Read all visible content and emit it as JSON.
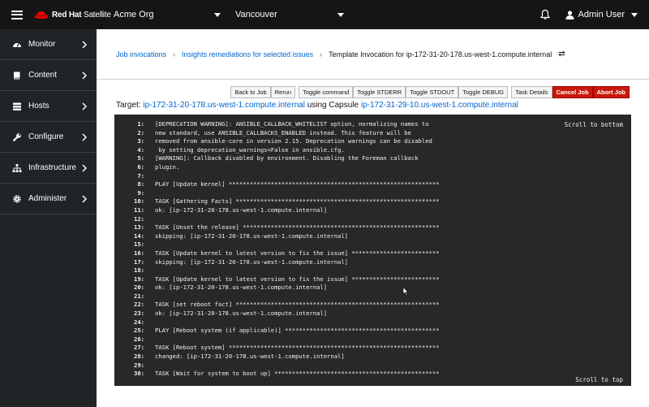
{
  "masthead": {
    "brand_bold": "Red Hat",
    "brand_light": " Satellite",
    "organization": "Acme Org",
    "location": "Vancouver",
    "user": "Admin User"
  },
  "sidebar": {
    "items": [
      {
        "label": "Monitor",
        "icon": "dashboard-icon"
      },
      {
        "label": "Content",
        "icon": "book-icon"
      },
      {
        "label": "Hosts",
        "icon": "server-icon"
      },
      {
        "label": "Configure",
        "icon": "wrench-icon"
      },
      {
        "label": "Infrastructure",
        "icon": "network-icon"
      },
      {
        "label": "Administer",
        "icon": "gear-icon"
      }
    ]
  },
  "breadcrumb": {
    "items": [
      "Job invocations",
      "Insights remediations for selected issues"
    ],
    "current": "Template Invocation for ip-172-31-20-178.us-west-1.compute.internal",
    "switcher": "⇄"
  },
  "toolbar": {
    "back_to_job": "Back to Job",
    "rerun": "Rerun",
    "toggle_command": "Toggle command",
    "toggle_stderr": "Toggle STDERR",
    "toggle_stdout": "Toggle STDOUT",
    "toggle_debug": "Toggle DEBUG",
    "task_details": "Task Details",
    "cancel_job": "Cancel Job",
    "abort_job": "Abort Job"
  },
  "target": {
    "label": "Target:",
    "host": "ip-172-31-20-178.us-west-1.compute.internal",
    "using": "using Capsule",
    "capsule": "ip-172-31-29-10.us-west-1.compute.internal"
  },
  "terminal": {
    "scroll_to_bottom": "Scroll to bottom",
    "scroll_to_top": "Scroll to top",
    "lines": [
      {
        "n": "1:",
        "t": "[DEPRECATION WARNING]: ANSIBLE_CALLBACK_WHITELIST option, normalizing names to"
      },
      {
        "n": "2:",
        "t": "new standard, use ANSIBLE_CALLBACKS_ENABLED instead. This feature will be"
      },
      {
        "n": "3:",
        "t": "removed from ansible-core in version 2.15. Deprecation warnings can be disabled"
      },
      {
        "n": "4:",
        "t": " by setting deprecation_warnings=False in ansible.cfg."
      },
      {
        "n": "5:",
        "t": "[WARNING]: Callback disabled by environment. Disabling the Foreman callback"
      },
      {
        "n": "6:",
        "t": "plugin."
      },
      {
        "n": "7:",
        "t": ""
      },
      {
        "n": "8:",
        "t": "PLAY [Update kernel] ************************************************************"
      },
      {
        "n": "9:",
        "t": ""
      },
      {
        "n": "10:",
        "t": "TASK [Gathering Facts] **********************************************************"
      },
      {
        "n": "11:",
        "t": "ok: [ip-172-31-20-178.us-west-1.compute.internal]"
      },
      {
        "n": "12:",
        "t": ""
      },
      {
        "n": "13:",
        "t": "TASK [Unset the release] ********************************************************"
      },
      {
        "n": "14:",
        "t": "skipping: [ip-172-31-20-178.us-west-1.compute.internal]"
      },
      {
        "n": "15:",
        "t": ""
      },
      {
        "n": "16:",
        "t": "TASK [Update kernel to latest version to fix the issue] *************************"
      },
      {
        "n": "17:",
        "t": "skipping: [ip-172-31-20-178.us-west-1.compute.internal]"
      },
      {
        "n": "18:",
        "t": ""
      },
      {
        "n": "19:",
        "t": "TASK [Update kernel to latest version to fix the issue] *************************"
      },
      {
        "n": "20:",
        "t": "ok: [ip-172-31-20-178.us-west-1.compute.internal]"
      },
      {
        "n": "21:",
        "t": ""
      },
      {
        "n": "22:",
        "t": "TASK [set reboot fact] **********************************************************"
      },
      {
        "n": "23:",
        "t": "ok: [ip-172-31-20-178.us-west-1.compute.internal]"
      },
      {
        "n": "24:",
        "t": ""
      },
      {
        "n": "25:",
        "t": "PLAY [Reboot system (if applicable)] ********************************************"
      },
      {
        "n": "26:",
        "t": ""
      },
      {
        "n": "27:",
        "t": "TASK [Reboot system] ************************************************************"
      },
      {
        "n": "28:",
        "t": "changed: [ip-172-31-20-178.us-west-1.compute.internal]"
      },
      {
        "n": "29:",
        "t": ""
      },
      {
        "n": "30:",
        "t": "TASK [Wait for system to boot up] ***********************************************"
      }
    ]
  },
  "colors": {
    "masthead_bg": "#151515",
    "sidebar_bg": "#212427",
    "link": "#0066cc",
    "danger": "#c9190b",
    "terminal_bg": "#282828"
  }
}
